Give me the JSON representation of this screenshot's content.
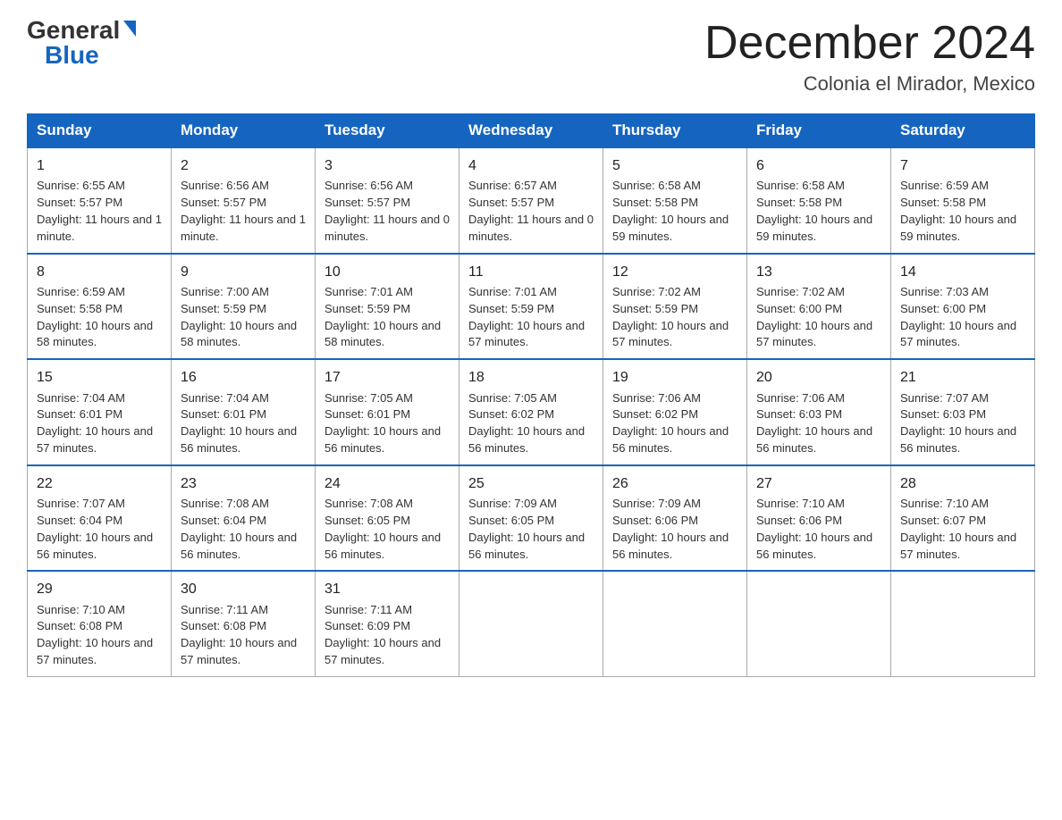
{
  "logo": {
    "general": "General",
    "blue": "Blue"
  },
  "title": "December 2024",
  "location": "Colonia el Mirador, Mexico",
  "days_of_week": [
    "Sunday",
    "Monday",
    "Tuesday",
    "Wednesday",
    "Thursday",
    "Friday",
    "Saturday"
  ],
  "weeks": [
    [
      {
        "day": "1",
        "sunrise": "6:55 AM",
        "sunset": "5:57 PM",
        "daylight": "11 hours and 1 minute."
      },
      {
        "day": "2",
        "sunrise": "6:56 AM",
        "sunset": "5:57 PM",
        "daylight": "11 hours and 1 minute."
      },
      {
        "day": "3",
        "sunrise": "6:56 AM",
        "sunset": "5:57 PM",
        "daylight": "11 hours and 0 minutes."
      },
      {
        "day": "4",
        "sunrise": "6:57 AM",
        "sunset": "5:57 PM",
        "daylight": "11 hours and 0 minutes."
      },
      {
        "day": "5",
        "sunrise": "6:58 AM",
        "sunset": "5:58 PM",
        "daylight": "10 hours and 59 minutes."
      },
      {
        "day": "6",
        "sunrise": "6:58 AM",
        "sunset": "5:58 PM",
        "daylight": "10 hours and 59 minutes."
      },
      {
        "day": "7",
        "sunrise": "6:59 AM",
        "sunset": "5:58 PM",
        "daylight": "10 hours and 59 minutes."
      }
    ],
    [
      {
        "day": "8",
        "sunrise": "6:59 AM",
        "sunset": "5:58 PM",
        "daylight": "10 hours and 58 minutes."
      },
      {
        "day": "9",
        "sunrise": "7:00 AM",
        "sunset": "5:59 PM",
        "daylight": "10 hours and 58 minutes."
      },
      {
        "day": "10",
        "sunrise": "7:01 AM",
        "sunset": "5:59 PM",
        "daylight": "10 hours and 58 minutes."
      },
      {
        "day": "11",
        "sunrise": "7:01 AM",
        "sunset": "5:59 PM",
        "daylight": "10 hours and 57 minutes."
      },
      {
        "day": "12",
        "sunrise": "7:02 AM",
        "sunset": "5:59 PM",
        "daylight": "10 hours and 57 minutes."
      },
      {
        "day": "13",
        "sunrise": "7:02 AM",
        "sunset": "6:00 PM",
        "daylight": "10 hours and 57 minutes."
      },
      {
        "day": "14",
        "sunrise": "7:03 AM",
        "sunset": "6:00 PM",
        "daylight": "10 hours and 57 minutes."
      }
    ],
    [
      {
        "day": "15",
        "sunrise": "7:04 AM",
        "sunset": "6:01 PM",
        "daylight": "10 hours and 57 minutes."
      },
      {
        "day": "16",
        "sunrise": "7:04 AM",
        "sunset": "6:01 PM",
        "daylight": "10 hours and 56 minutes."
      },
      {
        "day": "17",
        "sunrise": "7:05 AM",
        "sunset": "6:01 PM",
        "daylight": "10 hours and 56 minutes."
      },
      {
        "day": "18",
        "sunrise": "7:05 AM",
        "sunset": "6:02 PM",
        "daylight": "10 hours and 56 minutes."
      },
      {
        "day": "19",
        "sunrise": "7:06 AM",
        "sunset": "6:02 PM",
        "daylight": "10 hours and 56 minutes."
      },
      {
        "day": "20",
        "sunrise": "7:06 AM",
        "sunset": "6:03 PM",
        "daylight": "10 hours and 56 minutes."
      },
      {
        "day": "21",
        "sunrise": "7:07 AM",
        "sunset": "6:03 PM",
        "daylight": "10 hours and 56 minutes."
      }
    ],
    [
      {
        "day": "22",
        "sunrise": "7:07 AM",
        "sunset": "6:04 PM",
        "daylight": "10 hours and 56 minutes."
      },
      {
        "day": "23",
        "sunrise": "7:08 AM",
        "sunset": "6:04 PM",
        "daylight": "10 hours and 56 minutes."
      },
      {
        "day": "24",
        "sunrise": "7:08 AM",
        "sunset": "6:05 PM",
        "daylight": "10 hours and 56 minutes."
      },
      {
        "day": "25",
        "sunrise": "7:09 AM",
        "sunset": "6:05 PM",
        "daylight": "10 hours and 56 minutes."
      },
      {
        "day": "26",
        "sunrise": "7:09 AM",
        "sunset": "6:06 PM",
        "daylight": "10 hours and 56 minutes."
      },
      {
        "day": "27",
        "sunrise": "7:10 AM",
        "sunset": "6:06 PM",
        "daylight": "10 hours and 56 minutes."
      },
      {
        "day": "28",
        "sunrise": "7:10 AM",
        "sunset": "6:07 PM",
        "daylight": "10 hours and 57 minutes."
      }
    ],
    [
      {
        "day": "29",
        "sunrise": "7:10 AM",
        "sunset": "6:08 PM",
        "daylight": "10 hours and 57 minutes."
      },
      {
        "day": "30",
        "sunrise": "7:11 AM",
        "sunset": "6:08 PM",
        "daylight": "10 hours and 57 minutes."
      },
      {
        "day": "31",
        "sunrise": "7:11 AM",
        "sunset": "6:09 PM",
        "daylight": "10 hours and 57 minutes."
      },
      null,
      null,
      null,
      null
    ]
  ]
}
